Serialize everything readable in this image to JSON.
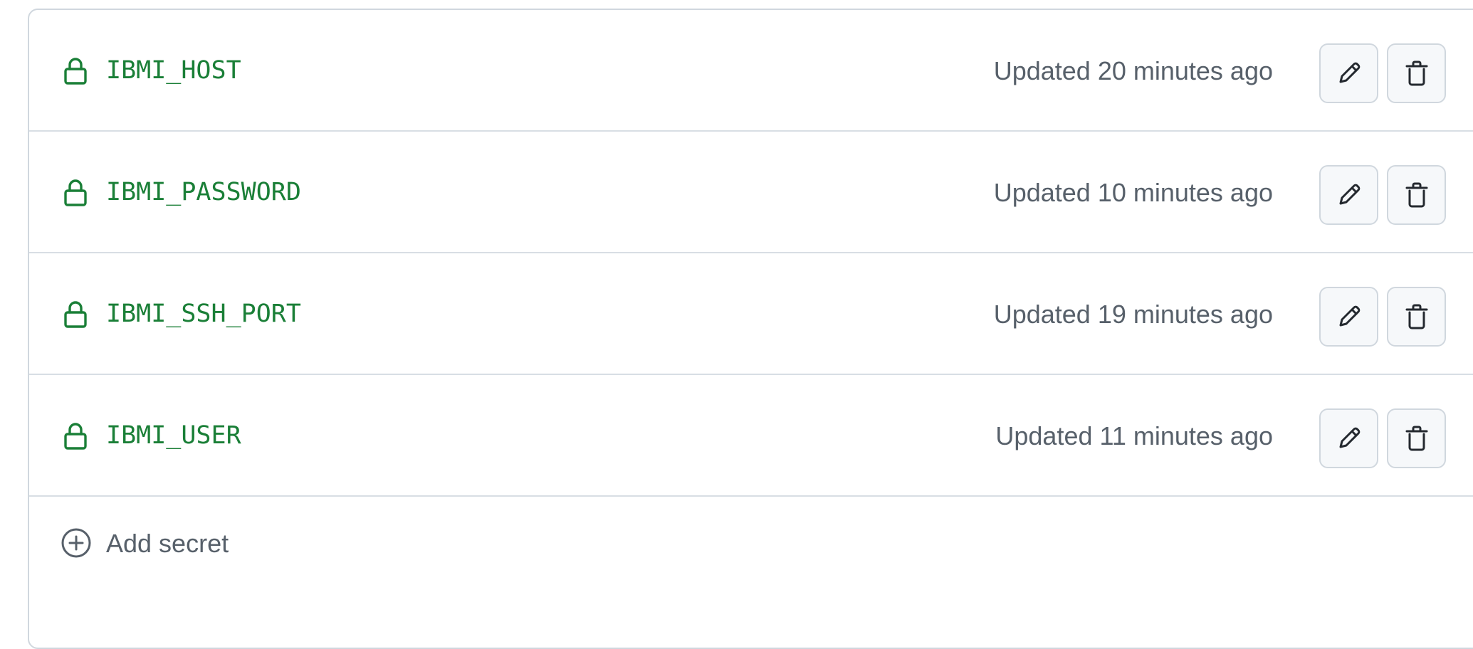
{
  "secrets": [
    {
      "name": "IBMI_HOST",
      "updated": "Updated 20 minutes ago"
    },
    {
      "name": "IBMI_PASSWORD",
      "updated": "Updated 10 minutes ago"
    },
    {
      "name": "IBMI_SSH_PORT",
      "updated": "Updated 19 minutes ago"
    },
    {
      "name": "IBMI_USER",
      "updated": "Updated 11 minutes ago"
    }
  ],
  "actions": {
    "edit_icon": "pencil-icon",
    "delete_icon": "trash-icon"
  },
  "add": {
    "label": "Add secret",
    "icon": "plus-circle-icon"
  },
  "colors": {
    "secret_name": "#1a7f37",
    "muted_text": "#57606a",
    "border": "#d0d7de",
    "button_bg": "#f6f8fa"
  }
}
